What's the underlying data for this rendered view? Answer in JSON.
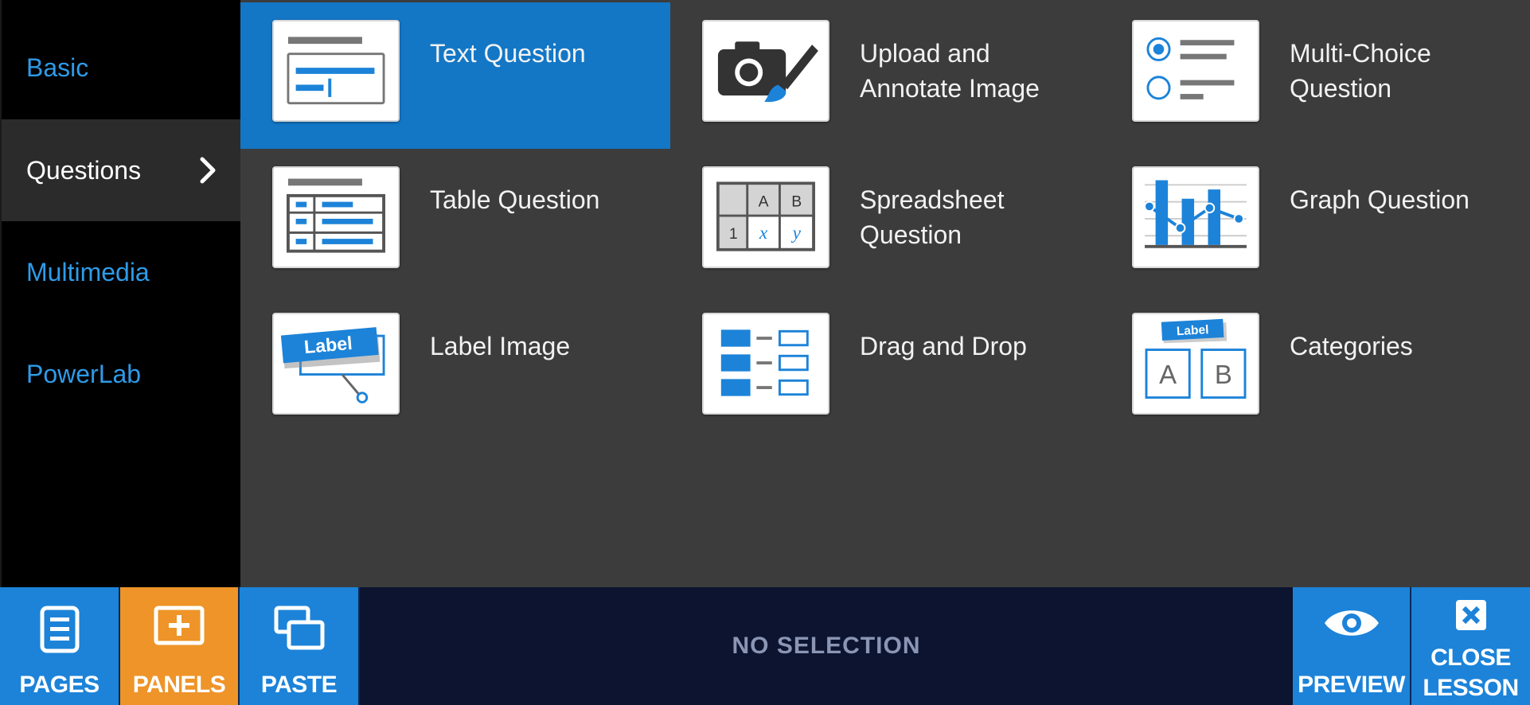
{
  "sidebar": {
    "items": [
      {
        "label": "Basic"
      },
      {
        "label": "Questions"
      },
      {
        "label": "Multimedia"
      },
      {
        "label": "PowerLab"
      }
    ]
  },
  "tiles": [
    {
      "label": "Text Question",
      "icon": "text-question-icon"
    },
    {
      "label": "Upload and\nAnnotate Image",
      "icon": "camera-brush-icon"
    },
    {
      "label": "Multi-Choice\nQuestion",
      "icon": "multi-choice-icon"
    },
    {
      "label": "Table Question",
      "icon": "table-question-icon"
    },
    {
      "label": "Spreadsheet\nQuestion",
      "icon": "spreadsheet-icon",
      "cells": [
        "A",
        "B",
        "1",
        "x",
        "y"
      ]
    },
    {
      "label": "Graph Question",
      "icon": "graph-icon"
    },
    {
      "label": "Label Image",
      "icon": "label-image-icon",
      "badge": "Label"
    },
    {
      "label": "Drag and Drop",
      "icon": "drag-drop-icon"
    },
    {
      "label": "Categories",
      "icon": "categories-icon",
      "badge": "Label",
      "cells": [
        "A",
        "B"
      ]
    }
  ],
  "toolbar": {
    "pages": "PAGES",
    "panels": "PANELS",
    "paste": "PASTE",
    "status": "NO SELECTION",
    "preview": "PREVIEW",
    "close": "CLOSE\nLESSON"
  },
  "colors": {
    "accent_blue": "#1c83d9",
    "selected_tile": "#1377c6",
    "orange": "#ee9428",
    "sidebar_link": "#2e9be8"
  }
}
